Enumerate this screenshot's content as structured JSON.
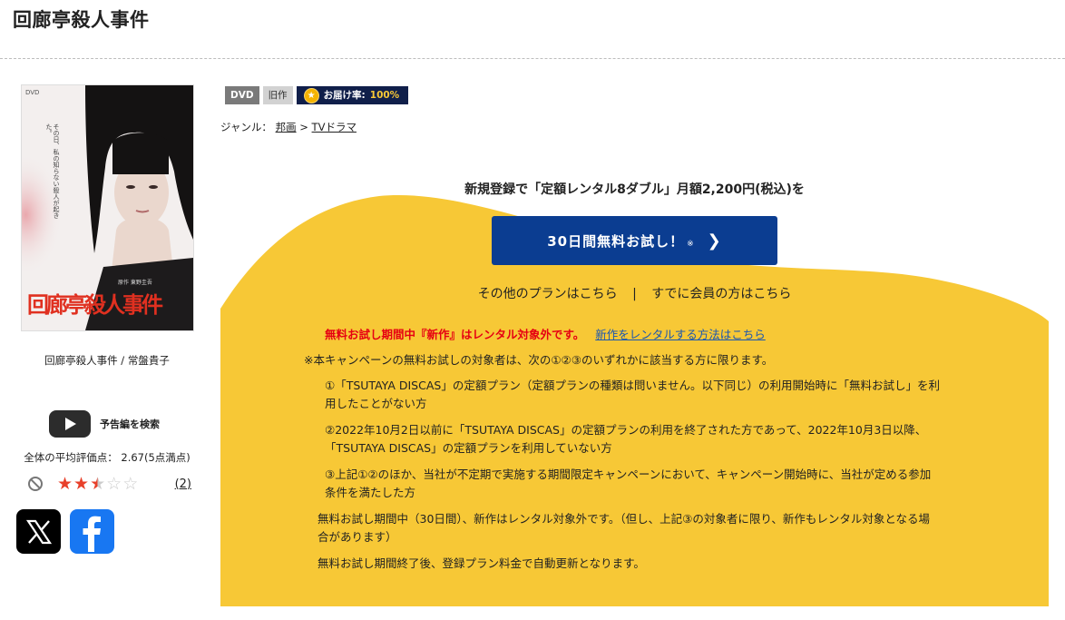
{
  "page": {
    "title": "回廊亭殺人事件"
  },
  "product": {
    "caption": "回廊亭殺人事件 / 常盤貴子",
    "poster_title": "回廊亭殺人事件",
    "poster_tagline": "その日、私の知らない殺人が起きた。",
    "poster_credit": "原作 東野圭吾",
    "poster_dvd": "DVD"
  },
  "trailer": {
    "label": "予告編を検索"
  },
  "rating": {
    "text": "全体の平均評価点： 2.67(5点満点)",
    "value": 2.67,
    "max": 5,
    "count": "(2)"
  },
  "badges": {
    "format": "DVD",
    "type": "旧作",
    "delivery_label": "お届け率:",
    "delivery_value": "100%"
  },
  "genre": {
    "label": "ジャンル：",
    "crumbs": [
      "邦画",
      "TVドラマ"
    ],
    "separator": ">"
  },
  "campaign": {
    "headline": "新規登録で「定額レンタル8ダブル」月額2,200円(税込)を",
    "cta_label": "30日間無料お試し！",
    "cta_note": "※",
    "other_plans": "その他のプランはこちら",
    "separator": "|",
    "members": "すでに会員の方はこちら",
    "notice_red": "無料お試し期間中『新作』はレンタル対象外です。",
    "notice_link": "新作をレンタルする方法はこちら",
    "terms": {
      "intro": "※本キャンペーンの無料お試しの対象者は、次の①②③のいずれかに該当する方に限ります。",
      "item1_line1": "①「TSUTAYA DISCAS」の定額プラン（定額プランの種類は問いません。以下同じ）の利用開始時に「無料お試し」を利",
      "item1_line2": "用したことがない方",
      "item2_line1": "②2022年10月2日以前に「TSUTAYA DISCAS」の定額プランの利用を終了された方であって、2022年10月3日以降、",
      "item2_line2": "「TSUTAYA DISCAS」の定額プランを利用していない方",
      "item3_line1": "③上記①②のほか、当社が不定期で実施する期間限定キャンペーンにおいて、キャンペーン開始時に、当社が定める参加",
      "item3_line2": "条件を満たした方",
      "trial_line1": "無料お試し期間中（30日間）、新作はレンタル対象外です。（但し、上記③の対象者に限り、新作もレンタル対象となる場",
      "trial_line2": "合があります）",
      "renewal": "無料お試し期間終了後、登録プラン料金で自動更新となります。"
    }
  },
  "social": {
    "x_icon": "x-logo-icon",
    "facebook_icon": "facebook-logo-icon"
  },
  "colors": {
    "promo_yellow": "#f7c836",
    "cta_blue": "#0b3d91",
    "star_red": "#e8402a",
    "notice_red": "#e60012",
    "link_blue": "#1a56b0"
  }
}
